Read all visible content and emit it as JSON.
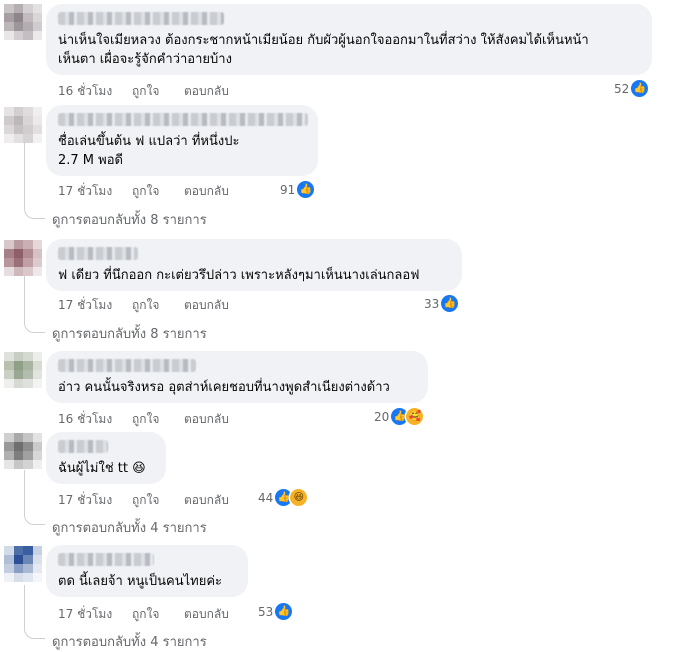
{
  "comments": [
    {
      "text": "น่าเห็นใจเมียหลวง ต้องกระชากหน้าเมียน้อย กับผัวผู้นอกใจออกมาในที่สว่าง ให้สังคมได้เห็นหน้า\nเห็นตา เผื่อจะรู้จักคำว่าอายบ้าง",
      "time": "16 ชั่วโมง",
      "like": "ถูกใจ",
      "reply": "ตอบกลับ",
      "count": "52",
      "reactions": [
        "like"
      ]
    },
    {
      "text": "ชื่อเล่นขึ้นต้น ฟ แปลว่า ที่หนึ่งปะ\n2.7 M พอดี",
      "time": "17 ชั่วโมง",
      "like": "ถูกใจ",
      "reply": "ตอบกลับ",
      "count": "91",
      "reactions": [
        "like"
      ],
      "more": "ดูการตอบกลับทั้ง 8 รายการ"
    },
    {
      "text": "ฟ เดียว ที่นึกออก กะเต่ยวรึปล่าว เพราะหลังๆมาเห็นนางเล่นกลอฟ",
      "time": "17 ชั่วโมง",
      "like": "ถูกใจ",
      "reply": "ตอบกลับ",
      "count": "33",
      "reactions": [
        "like"
      ],
      "more": "ดูการตอบกลับทั้ง 8 รายการ"
    },
    {
      "text": "อ่าว คนนั้นจริงหรอ อุตส่าห์เคยชอบที่นางพูดสำเนียงต่างด้าว",
      "time": "16 ชั่วโมง",
      "like": "ถูกใจ",
      "reply": "ตอบกลับ",
      "count": "20",
      "reactions": [
        "like",
        "care"
      ]
    },
    {
      "text": "ฉันผู้ไม่ใช่ tt 😆",
      "time": "17 ชั่วโมง",
      "like": "ถูกใจ",
      "reply": "ตอบกลับ",
      "count": "44",
      "reactions": [
        "like",
        "haha"
      ],
      "more": "ดูการตอบกลับทั้ง 4 รายการ"
    },
    {
      "text": "ตด นี้เลยจ้า หนูเป็นคนไทยค่ะ",
      "time": "17 ชั่วโมง",
      "like": "ถูกใจ",
      "reply": "ตอบกลับ",
      "count": "53",
      "reactions": [
        "like"
      ],
      "more": "ดูการตอบกลับทั้ง 4 รายการ"
    }
  ],
  "colors": {
    "bubble": "#f0f2f5",
    "meta": "#65676b",
    "like_blue": "#1877f2"
  },
  "icons": {
    "like": "thumbs-up-icon",
    "care": "care-emoji-icon",
    "haha": "haha-emoji-icon"
  }
}
